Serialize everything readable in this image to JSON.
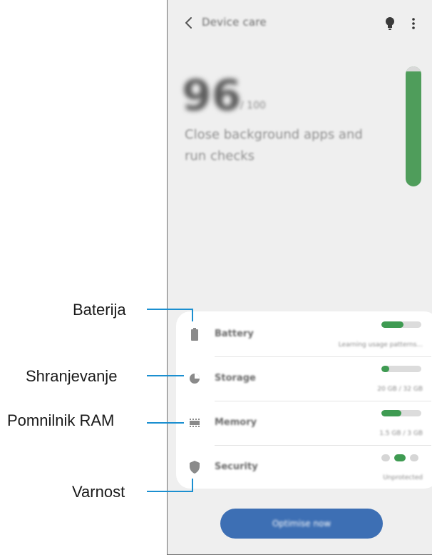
{
  "header": {
    "back_icon": "chevron-left-icon",
    "title": "Device care",
    "tips_icon": "lightbulb-icon",
    "more_icon": "more-vertical-icon"
  },
  "summary": {
    "score": "96",
    "score_unit": "/ 100",
    "message_line1": "Close background apps and",
    "message_line2": "run checks",
    "score_fraction": 0.96
  },
  "items": [
    {
      "key": "battery",
      "icon": "battery-icon",
      "name": "Battery",
      "status": "Learning usage patterns...",
      "level": 0.55
    },
    {
      "key": "storage",
      "icon": "storage-pie-icon",
      "name": "Storage",
      "status": "20 GB / 32 GB",
      "level": 0.2
    },
    {
      "key": "memory",
      "icon": "memory-chip-icon",
      "name": "Memory",
      "status": "1.5 GB / 3 GB",
      "level": 0.5
    },
    {
      "key": "security",
      "icon": "shield-icon",
      "name": "Security",
      "status": "Unprotected",
      "dots": 3,
      "active_dot": 1
    }
  ],
  "optimize_button": "Optimise now",
  "callouts": {
    "battery": "Baterija",
    "storage": "Shranjevanje",
    "memory": "Pomnilnik RAM",
    "security": "Varnost"
  },
  "colors": {
    "accent_green": "#3f9b52",
    "button_blue": "#3d6fb4",
    "screen_bg": "#efefef"
  }
}
